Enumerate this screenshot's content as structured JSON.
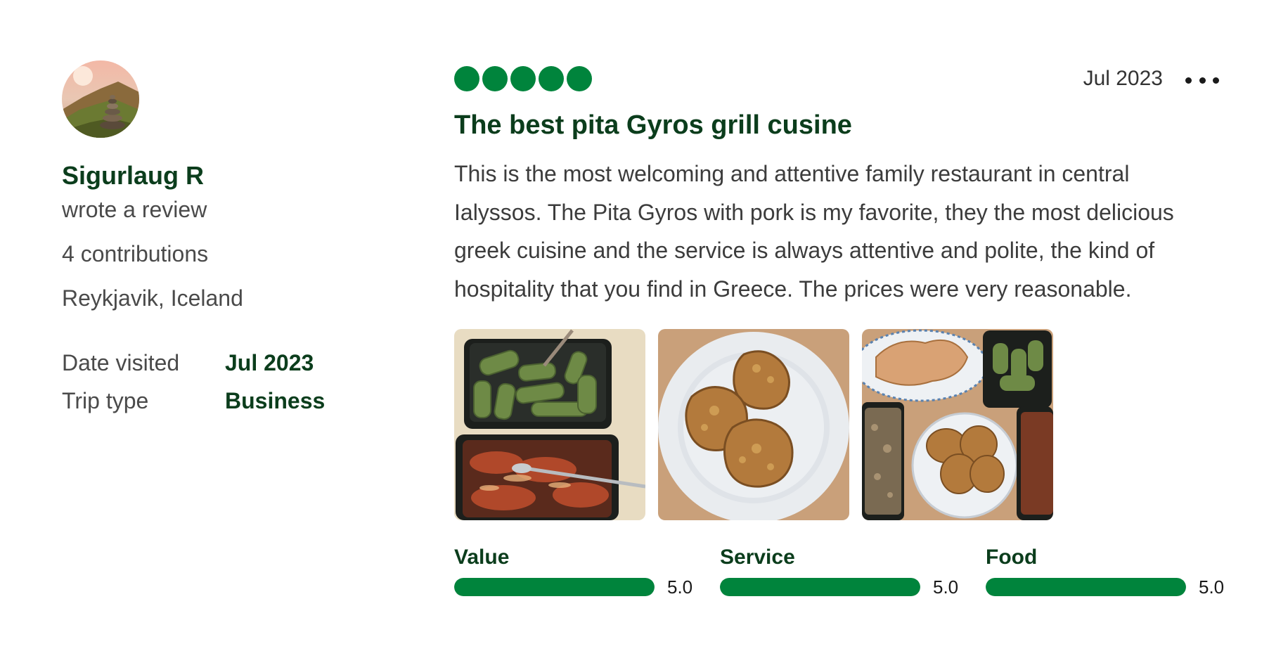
{
  "accent_color": "#00843c",
  "reviewer": {
    "avatar_icon": "reviewer-avatar",
    "name": "Sigurlaug R",
    "action": "wrote a review",
    "contributions": "4 contributions",
    "location": "Reykjavik, Iceland",
    "details": [
      {
        "label": "Date visited",
        "value": "Jul 2023"
      },
      {
        "label": "Trip type",
        "value": "Business"
      }
    ]
  },
  "review": {
    "rating": 5,
    "rating_max": 5,
    "date": "Jul 2023",
    "more_icon": "more-horizontal-icon",
    "title": "The best pita Gyros grill cusine",
    "body": "This is the most welcoming and attentive family restaurant in central Ialyssos. The Pita Gyros with pork is my favorite, they the most delicious greek cuisine and the service is always attentive and polite, the kind of hospitality that you find in Greece. The prices were very reasonable.",
    "photos": [
      {
        "name": "photo-dolmades-and-stew"
      },
      {
        "name": "photo-fritters-plate"
      },
      {
        "name": "photo-table-spread"
      }
    ],
    "subratings": [
      {
        "label": "Value",
        "score": "5.0",
        "fraction": 1.0
      },
      {
        "label": "Service",
        "score": "5.0",
        "fraction": 1.0
      },
      {
        "label": "Food",
        "score": "5.0",
        "fraction": 1.0
      }
    ]
  }
}
